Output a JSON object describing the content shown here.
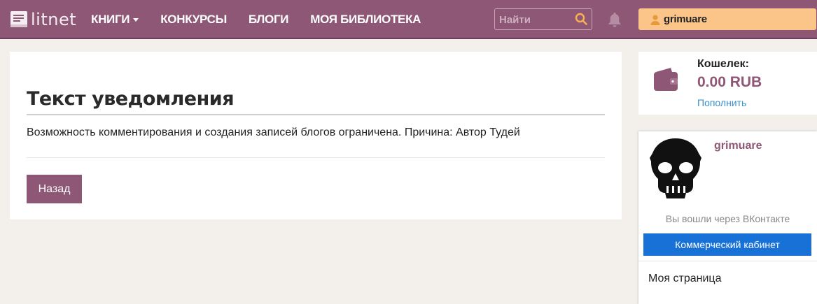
{
  "header": {
    "logo_text": "litnet",
    "nav": [
      {
        "label": "Книги",
        "has_dropdown": true
      },
      {
        "label": "Конкурсы"
      },
      {
        "label": "Блоги"
      },
      {
        "label": "Моя библиотека"
      }
    ],
    "search_placeholder": "Найти",
    "username": "grimuare"
  },
  "notice": {
    "title": "Текст уведомления",
    "text": "Возможность комментирования и создания записей блогов ограничена. Причина: Автор Тудей",
    "back_label": "Назад"
  },
  "wallet": {
    "label": "Кошелек:",
    "balance": "0.00 RUB",
    "topup_label": "Пополнить"
  },
  "profile": {
    "name": "grimuare",
    "login_note": "Вы вошли через ВКонтакте",
    "commercial_label": "Коммерческий кабинет",
    "my_page_label": "Моя страница"
  },
  "colors": {
    "brand": "#8e5775",
    "user_pill": "#fbc58a",
    "commercial": "#1771d6",
    "link": "#3a8fc7"
  },
  "icons": [
    "book-logo-icon",
    "search-icon",
    "bell-icon",
    "user-icon",
    "wallet-icon",
    "skull-avatar"
  ]
}
